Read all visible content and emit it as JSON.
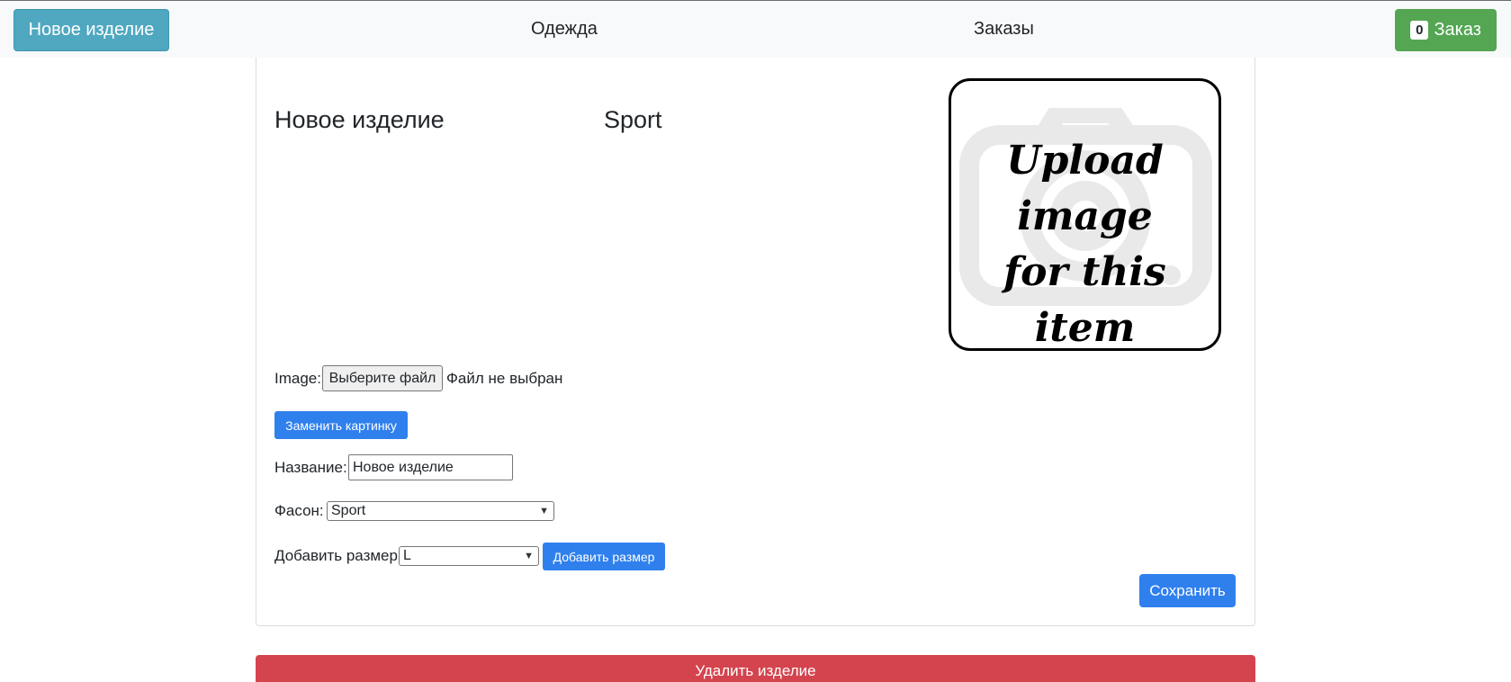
{
  "header": {
    "new_item_button": "Новое изделие",
    "nav_clothes": "Одежда",
    "nav_orders": "Заказы",
    "cart_count": "0",
    "cart_label": "Заказ"
  },
  "item": {
    "title": "Новое изделие",
    "style": "Sport"
  },
  "image_placeholder": {
    "line1": "Upload image",
    "line2": "for this",
    "line3": "item",
    "icon": "camera-icon"
  },
  "form": {
    "image_label": "Image:",
    "file_button": "Выберите файл",
    "file_status": "Файл не выбран",
    "replace_image_button": "Заменить картинку",
    "name_label": "Название:",
    "name_value": "Новое изделие",
    "style_label": "Фасон:",
    "style_value": "Sport",
    "size_label": "Добавить размер:",
    "size_value": "L",
    "add_size_button": "Добавить размер",
    "save_button": "Сохранить"
  },
  "footer": {
    "delete_button": "Удалить изделие"
  },
  "colors": {
    "info": "#4fa8c0",
    "success": "#54a653",
    "primary": "#2f80ed",
    "danger": "#d4444e"
  }
}
